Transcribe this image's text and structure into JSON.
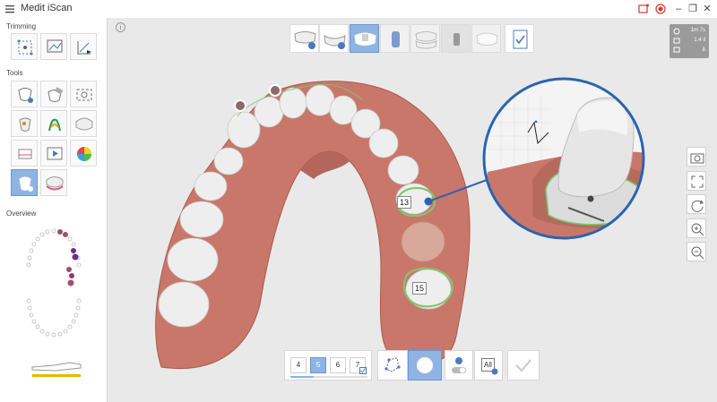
{
  "app": {
    "title": "Medit iScan"
  },
  "window_controls": {
    "minimize": "–",
    "maximize": "❐",
    "close": "✕"
  },
  "sidebar": {
    "trimming_label": "Trimming",
    "tools_label": "Tools",
    "overview_label": "Overview"
  },
  "viewport": {
    "info_icon": "i",
    "tooth_labels": [
      "13",
      "15"
    ],
    "info_box": {
      "line1": "1m 7s",
      "line2": "1.4 ll",
      "line3": "8"
    }
  },
  "bottom": {
    "steps": [
      "4",
      "5",
      "6",
      "7"
    ],
    "active_step": "5",
    "all_label": "All"
  },
  "colors": {
    "accent": "#8fb4e3",
    "gum": "#c9776a",
    "tooth": "#eeeeee",
    "margin_line": "#7ec86b",
    "zoom_ring": "#2a64b0"
  }
}
